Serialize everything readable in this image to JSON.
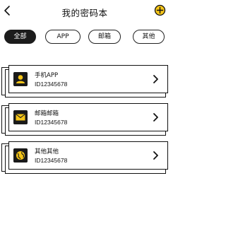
{
  "header": {
    "title": "我的密码本",
    "back_icon": "chevron-left-icon",
    "add_icon": "plus-circle-icon"
  },
  "tabs": [
    {
      "label": "全部",
      "active": true
    },
    {
      "label": "APP",
      "active": false
    },
    {
      "label": "邮箱",
      "active": false
    },
    {
      "label": "其他",
      "active": false
    }
  ],
  "entries": [
    {
      "name": "手机APP",
      "id": "ID12345678",
      "icon": "user-icon"
    },
    {
      "name": "邮箱邮箱",
      "id": "ID12345678",
      "icon": "envelope-icon"
    },
    {
      "name": "其他其他",
      "id": "ID12345678",
      "icon": "globe-icon"
    }
  ],
  "colors": {
    "accent": "#f5c518",
    "dark": "#1c1c1c",
    "background": "#ffffff"
  }
}
